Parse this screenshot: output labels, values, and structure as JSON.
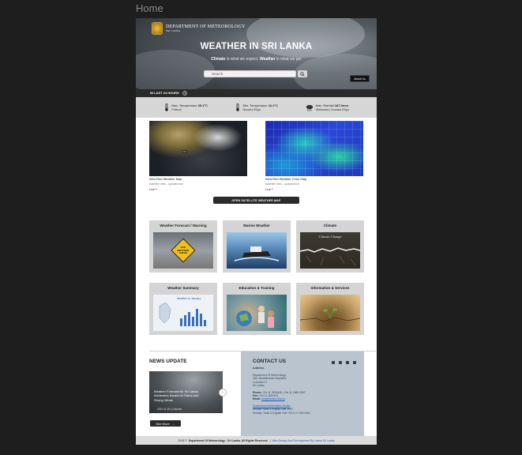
{
  "frame": {
    "title": "Home"
  },
  "header": {
    "logo_line1": "DEPARTMENT OF METEOROLOGY",
    "logo_line2": "SRI LANKA",
    "title": "WEATHER IN SRI LANKA",
    "tagline_b1": "Climate",
    "tagline_t1": " is what we expect, ",
    "tagline_b2": "Weather",
    "tagline_t2": " is what we get",
    "search_placeholder": "Search",
    "about_label": "About Us"
  },
  "last24": {
    "label": "IN LAST 24 HOURS",
    "stats": [
      {
        "label": "Max. Temperature",
        "value": "35.1°C",
        "location": "Pottuvil",
        "icon": "thermometer-icon"
      },
      {
        "label": "Min. Temperature",
        "value": "16.1°C",
        "location": "Nuwara Eliya",
        "icon": "thermometer-icon"
      },
      {
        "label": "Max. Rainfall",
        "value": "187.0mm",
        "location": "Watawala | Nuwara Eliya",
        "icon": "rain-cloud-icon"
      }
    ]
  },
  "satellite": {
    "maps": [
      {
        "title": "Infra Red Weather Map",
        "subtitle": "Satellite View - updated live",
        "live": "Live"
      },
      {
        "title": "Infra Red Weather Color Map",
        "subtitle": "Satellite View - updated live",
        "live": "Live"
      }
    ],
    "open_label": "OPEN SATELLITE WEATHER MAP"
  },
  "cards": [
    {
      "title": "Weather Forecast / Warning",
      "image_text": "BAD WEATHER AHEAD"
    },
    {
      "title": "Marine Weather"
    },
    {
      "title": "Climate",
      "image_text": "Climate Change"
    },
    {
      "title": "Weather Summary",
      "image_text": "Weather in January"
    },
    {
      "title": "Education & Training"
    },
    {
      "title": "Information & Services"
    }
  ],
  "news": {
    "title": "NEWS UPDATE",
    "item_caption": "Weather Forecast for Sri Lanka: Advisories Issued for Rains And Strong Winds",
    "item_date": "2024 01 28 | Colombo",
    "see_more": "See More"
  },
  "contact": {
    "title": "CONTACT US",
    "address_label": "Address",
    "address_lines": [
      "Department Of Meteorology,",
      "383, Bauddhaloka Mawatha,",
      "Colombo 07",
      "Sri Lanka."
    ],
    "phone_label": "Phone:",
    "phone_value": "+94 11 2694846 | +94 11 2684 9057",
    "fax_label": "Fax:",
    "fax_value": "+94 11 2694104",
    "email_label": "Email:",
    "email_value": "info@Meteo.Gov.Lk",
    "info_centre_label": "Government Information Centre",
    "info_centre_line1": "Sinhala Tamil & English Dial 1919",
    "info_centre_line2": "Sinhala, Tamil & English Dial +94 11 2 1919 Bhd"
  },
  "footer": {
    "copyright_a": "2018 ©",
    "copyright_b": "Department Of Meteorology - Sri Lanka. All Rights Reserved.",
    "credit": "Web Design And Development By Lanka Sri Lanka"
  },
  "colors": {
    "brand_dark": "#2b2b2b",
    "contact_bg": "#b9c4cf",
    "live_dot": "#dd2222",
    "link": "#2157b5"
  }
}
